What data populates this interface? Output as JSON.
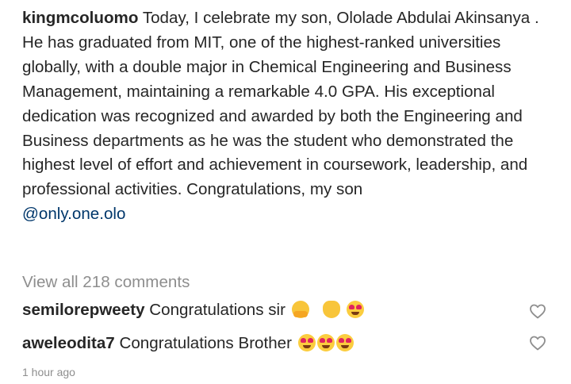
{
  "post": {
    "author": "kingmcoluomo",
    "caption_text": "Today, I celebrate my son, Ololade Abdulai Akinsanya . He has graduated from MIT, one of the highest-ranked universities globally, with a double major in Chemical Engineering and Business Management, maintaining a remarkable 4.0 GPA. His exceptional dedication was recognized and awarded by both the Engineering and Business departments as he was the student who demonstrated the highest level of effort and achievement in coursework, leadership, and professional activities. Congratulations, my son",
    "mention": "@only.one.olo"
  },
  "comments_summary": {
    "view_all_label": "View all 218 comments"
  },
  "comments": [
    {
      "username": "semilorepweety",
      "text": "Congratulations sir",
      "emojis": [
        "hugging-face",
        "clapping-hands",
        "heart-eyes"
      ]
    },
    {
      "username": "aweleodita7",
      "text": "Congratulations Brother",
      "emojis": [
        "heart-eyes",
        "heart-eyes",
        "heart-eyes"
      ]
    }
  ],
  "timestamp": "1 hour ago",
  "icons": {
    "like": "heart-outline-icon"
  },
  "colors": {
    "text": "#262626",
    "secondary": "#8e8e8e",
    "mention": "#00376b"
  }
}
